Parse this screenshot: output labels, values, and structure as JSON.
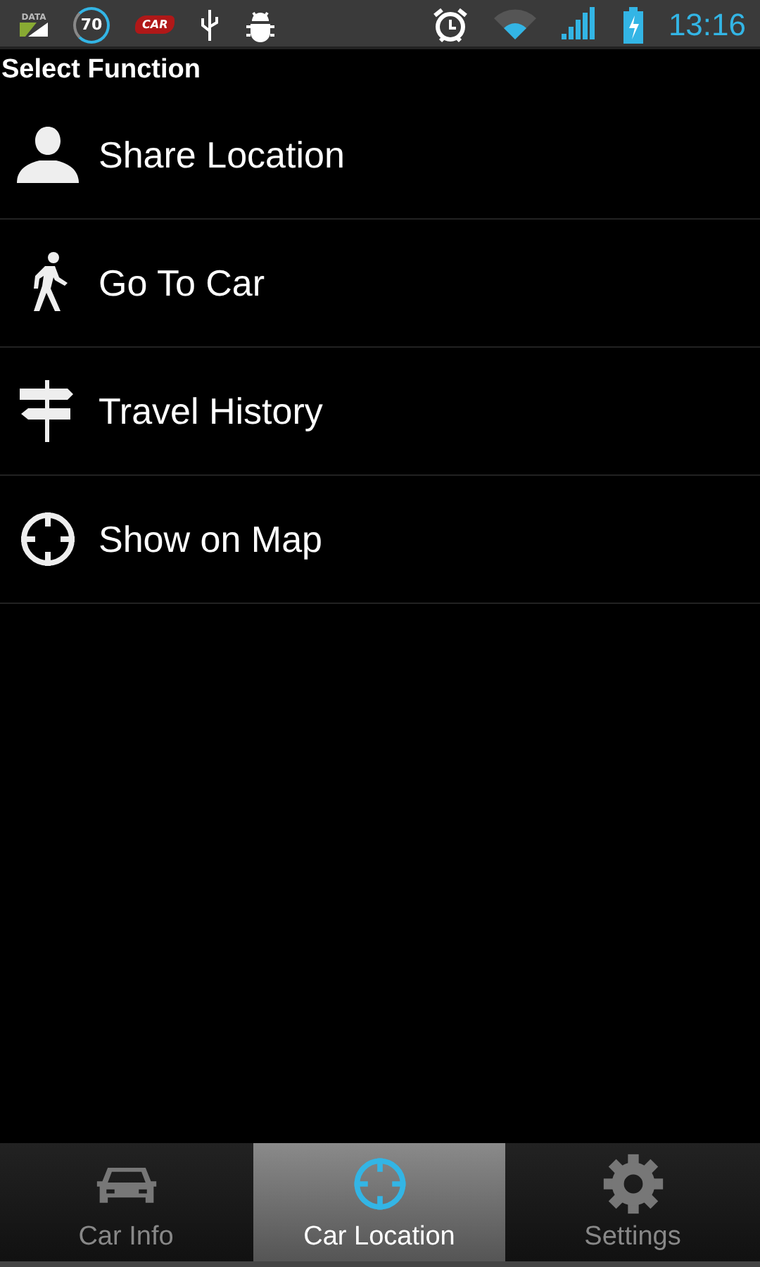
{
  "status_bar": {
    "data_label": "DATA",
    "speed": "70",
    "app_badge": "CAR",
    "time": "13:16"
  },
  "title": "Select Function",
  "functions": [
    {
      "kind": "person",
      "label": "Share Location"
    },
    {
      "kind": "walker",
      "label": "Go To Car"
    },
    {
      "kind": "signpost",
      "label": "Travel History"
    },
    {
      "kind": "crosshair",
      "label": "Show on Map"
    }
  ],
  "tabs": [
    {
      "kind": "car",
      "label": "Car Info",
      "selected": false
    },
    {
      "kind": "crosshair",
      "label": "Car Location",
      "selected": true
    },
    {
      "kind": "gear",
      "label": "Settings",
      "selected": false
    }
  ]
}
